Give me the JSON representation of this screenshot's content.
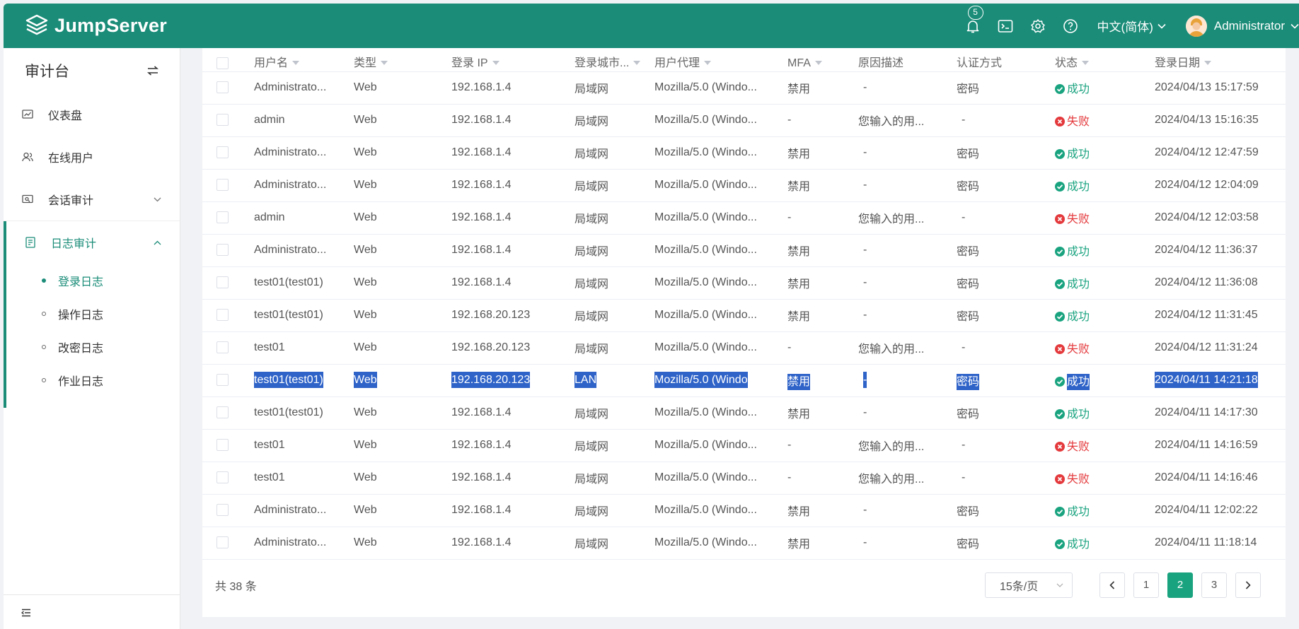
{
  "header": {
    "brand": "JumpServer",
    "notification_count": "5",
    "language": "中文(简体)",
    "username": "Administrator"
  },
  "sidebar": {
    "title": "审计台",
    "items": [
      {
        "label": "仪表盘"
      },
      {
        "label": "在线用户"
      },
      {
        "label": "会话审计"
      },
      {
        "label": "日志审计"
      }
    ],
    "subitems": [
      {
        "label": "登录日志"
      },
      {
        "label": "操作日志"
      },
      {
        "label": "改密日志"
      },
      {
        "label": "作业日志"
      }
    ]
  },
  "table": {
    "columns": [
      "用户名",
      "类型",
      "登录 IP",
      "登录城市...",
      "用户代理",
      "MFA",
      "原因描述",
      "认证方式",
      "状态",
      "登录日期"
    ],
    "rows": [
      {
        "user": "Administrato...",
        "type": "Web",
        "ip": "192.168.1.4",
        "city": "局域网",
        "ua": "Mozilla/5.0 (Windo...",
        "mfa": "禁用",
        "reason": "-",
        "auth": "密码",
        "status": "成功",
        "date": "2024/04/13 15:17:59"
      },
      {
        "user": "admin",
        "type": "Web",
        "ip": "192.168.1.4",
        "city": "局域网",
        "ua": "Mozilla/5.0 (Windo...",
        "mfa": "-",
        "reason": "您输入的用...",
        "auth": "-",
        "status": "失败",
        "date": "2024/04/13 15:16:35"
      },
      {
        "user": "Administrato...",
        "type": "Web",
        "ip": "192.168.1.4",
        "city": "局域网",
        "ua": "Mozilla/5.0 (Windo...",
        "mfa": "禁用",
        "reason": "-",
        "auth": "密码",
        "status": "成功",
        "date": "2024/04/12 12:47:59"
      },
      {
        "user": "Administrato...",
        "type": "Web",
        "ip": "192.168.1.4",
        "city": "局域网",
        "ua": "Mozilla/5.0 (Windo...",
        "mfa": "禁用",
        "reason": "-",
        "auth": "密码",
        "status": "成功",
        "date": "2024/04/12 12:04:09"
      },
      {
        "user": "admin",
        "type": "Web",
        "ip": "192.168.1.4",
        "city": "局域网",
        "ua": "Mozilla/5.0 (Windo...",
        "mfa": "-",
        "reason": "您输入的用...",
        "auth": "-",
        "status": "失败",
        "date": "2024/04/12 12:03:58"
      },
      {
        "user": "Administrato...",
        "type": "Web",
        "ip": "192.168.1.4",
        "city": "局域网",
        "ua": "Mozilla/5.0 (Windo...",
        "mfa": "禁用",
        "reason": "-",
        "auth": "密码",
        "status": "成功",
        "date": "2024/04/12 11:36:37"
      },
      {
        "user": "test01(test01)",
        "type": "Web",
        "ip": "192.168.1.4",
        "city": "局域网",
        "ua": "Mozilla/5.0 (Windo...",
        "mfa": "禁用",
        "reason": "-",
        "auth": "密码",
        "status": "成功",
        "date": "2024/04/12 11:36:08"
      },
      {
        "user": "test01(test01)",
        "type": "Web",
        "ip": "192.168.20.123",
        "city": "局域网",
        "ua": "Mozilla/5.0 (Windo...",
        "mfa": "禁用",
        "reason": "-",
        "auth": "密码",
        "status": "成功",
        "date": "2024/04/12 11:31:45"
      },
      {
        "user": "test01",
        "type": "Web",
        "ip": "192.168.20.123",
        "city": "局域网",
        "ua": "Mozilla/5.0 (Windo...",
        "mfa": "-",
        "reason": "您输入的用...",
        "auth": "-",
        "status": "失败",
        "date": "2024/04/12 11:31:24"
      },
      {
        "user": "test01(test01)",
        "type": "Web",
        "ip": "192.168.20.123",
        "city": "LAN",
        "ua": "Mozilla/5.0 (Windo",
        "mfa": "禁用",
        "reason": "-",
        "auth": "密码",
        "status": "成功",
        "date": "2024/04/11 14:21:18",
        "selected": true
      },
      {
        "user": "test01(test01)",
        "type": "Web",
        "ip": "192.168.1.4",
        "city": "局域网",
        "ua": "Mozilla/5.0 (Windo...",
        "mfa": "禁用",
        "reason": "-",
        "auth": "密码",
        "status": "成功",
        "date": "2024/04/11 14:17:30"
      },
      {
        "user": "test01",
        "type": "Web",
        "ip": "192.168.1.4",
        "city": "局域网",
        "ua": "Mozilla/5.0 (Windo...",
        "mfa": "-",
        "reason": "您输入的用...",
        "auth": "-",
        "status": "失败",
        "date": "2024/04/11 14:16:59"
      },
      {
        "user": "test01",
        "type": "Web",
        "ip": "192.168.1.4",
        "city": "局域网",
        "ua": "Mozilla/5.0 (Windo...",
        "mfa": "-",
        "reason": "您输入的用...",
        "auth": "-",
        "status": "失败",
        "date": "2024/04/11 14:16:46"
      },
      {
        "user": "Administrato...",
        "type": "Web",
        "ip": "192.168.1.4",
        "city": "局域网",
        "ua": "Mozilla/5.0 (Windo...",
        "mfa": "禁用",
        "reason": "-",
        "auth": "密码",
        "status": "成功",
        "date": "2024/04/11 12:02:22"
      },
      {
        "user": "Administrato...",
        "type": "Web",
        "ip": "192.168.1.4",
        "city": "局域网",
        "ua": "Mozilla/5.0 (Windo...",
        "mfa": "禁用",
        "reason": "-",
        "auth": "密码",
        "status": "成功",
        "date": "2024/04/11 11:18:14"
      }
    ]
  },
  "footer": {
    "total": "共 38 条",
    "page_size": "15条/页",
    "pages": [
      "1",
      "2",
      "3"
    ],
    "current_page": "2"
  },
  "colors": {
    "brand": "#1a8c78",
    "success": "#1aa37f",
    "fail": "#e4393c",
    "selection": "#2f63c8"
  }
}
